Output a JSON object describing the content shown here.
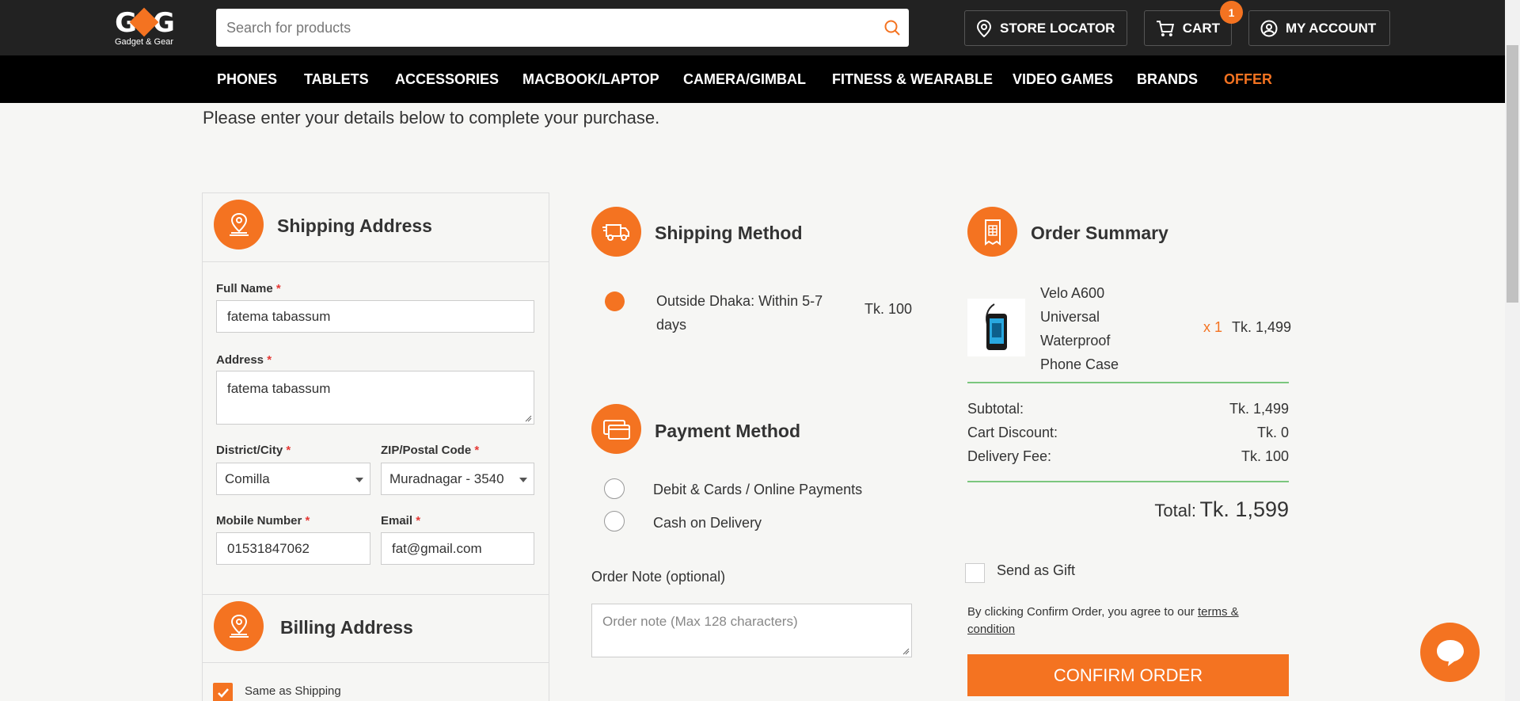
{
  "header": {
    "logo_text": "G&G",
    "logo_sub": "Gadget & Gear",
    "search_placeholder": "Search for products",
    "store_locator": "STORE LOCATOR",
    "cart": "CART",
    "cart_count": "1",
    "my_account": "MY ACCOUNT"
  },
  "nav": {
    "items": [
      "PHONES",
      "TABLETS",
      "ACCESSORIES",
      "MACBOOK/LAPTOP",
      "CAMERA/GIMBAL",
      "FITNESS & WEARABLE",
      "VIDEO GAMES",
      "BRANDS",
      "OFFER"
    ]
  },
  "intro": "Please enter your details below to complete your purchase.",
  "shipping_address": {
    "title": "Shipping Address",
    "full_name_label": "Full Name",
    "full_name": "fatema tabassum",
    "address_label": "Address",
    "address": "fatema tabassum",
    "district_label": "District/City",
    "district": "Comilla",
    "zip_label": "ZIP/Postal Code",
    "zip": "Muradnagar - 3540",
    "mobile_label": "Mobile Number",
    "mobile": "01531847062",
    "email_label": "Email",
    "email": "fat@gmail.com",
    "required_mark": "*"
  },
  "billing_address": {
    "title": "Billing Address",
    "same_as_shipping": "Same as Shipping"
  },
  "shipping_method": {
    "title": "Shipping Method",
    "option_line1": "Outside Dhaka: Within 5-7",
    "option_line2": "days",
    "option_price": "Tk. 100"
  },
  "payment_method": {
    "title": "Payment Method",
    "option1": "Debit & Cards / Online Payments",
    "option2": "Cash on Delivery"
  },
  "order_note": {
    "label": "Order Note (optional)",
    "placeholder": "Order note (Max 128 characters)"
  },
  "order_summary": {
    "title": "Order Summary",
    "product_lines": [
      "Velo A600",
      "Universal",
      "Waterproof",
      "Phone Case"
    ],
    "qty": "x 1",
    "price": "Tk. 1,499",
    "subtotal_label": "Subtotal:",
    "subtotal": "Tk. 1,499",
    "discount_label": "Cart Discount:",
    "discount": "Tk. 0",
    "delivery_label": "Delivery Fee:",
    "delivery": "Tk. 100",
    "total_label": "Total:",
    "total": "Tk. 1,599",
    "send_gift": "Send as Gift",
    "terms_prefix": "By clicking Confirm Order, you agree to our",
    "terms_link_1": "terms &",
    "terms_link_2": "condition",
    "confirm": "CONFIRM ORDER"
  },
  "colors": {
    "accent": "#f47321",
    "header_bg": "#222222",
    "nav_bg": "#000000",
    "divider": "#7bc67e"
  }
}
